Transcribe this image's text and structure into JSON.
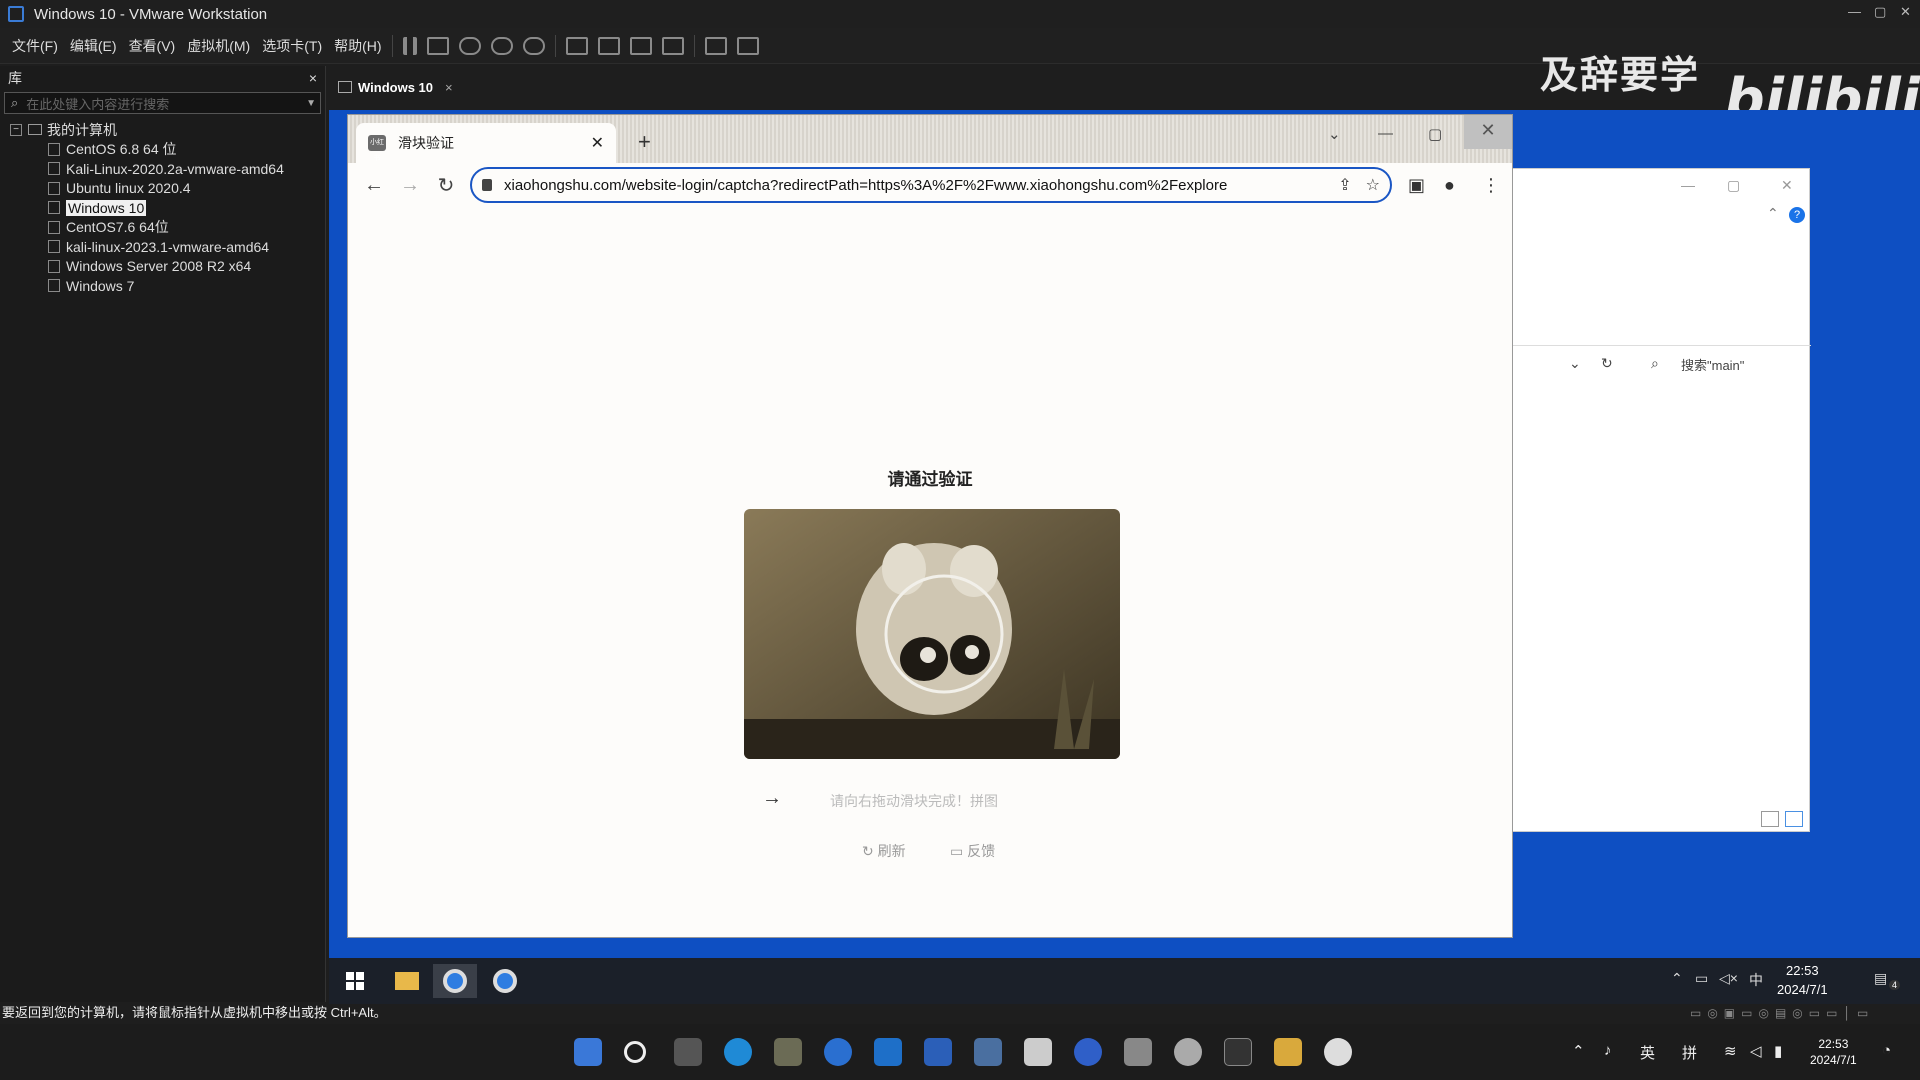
{
  "window": {
    "title": "Windows 10 - VMware Workstation"
  },
  "menu": [
    "文件(F)",
    "编辑(E)",
    "查看(V)",
    "虚拟机(M)",
    "选项卡(T)",
    "帮助(H)"
  ],
  "library": {
    "title": "库",
    "close": "×",
    "search_placeholder": "在此处键入内容进行搜索",
    "root": "我的计算机",
    "vms": [
      "CentOS 6.8 64 位",
      "Kali-Linux-2020.2a-vmware-amd64",
      "Ubuntu linux 2020.4",
      "Windows 10",
      "CentOS7.6 64位",
      "kali-linux-2023.1-vmware-amd64",
      "Windows Server 2008 R2 x64",
      "Windows 7"
    ],
    "selected": "Windows 10"
  },
  "vm_tab": {
    "label": "Windows 10",
    "close": "×"
  },
  "watermark": {
    "text": "及辞要学习",
    "logo": "bilibili"
  },
  "status_bar": {
    "text": "要返回到您的计算机，请将鼠标指针从虚拟机中移出或按 Ctrl+Alt。"
  },
  "chrome": {
    "tab_title": "滑块验证",
    "tab_favicon": "小红书",
    "new_tab": "+",
    "url": "xiaohongshu.com/website-login/captcha?redirectPath=https%3A%2F%2Fwww.xiaohongshu.com%2Fexplore",
    "page": {
      "title": "请通过验证",
      "slider_hint": "请向右拖动滑块完成！拼图",
      "refresh": "刷新",
      "feedback": "反馈"
    }
  },
  "explorer": {
    "search_placeholder": "搜索\"main\""
  },
  "guest_taskbar": {
    "time": "22:53",
    "date": "2024/7/1",
    "ime": "中",
    "notifications": "4"
  },
  "host_taskbar": {
    "time": "22:53",
    "date": "2024/7/1",
    "ime_lang": "英",
    "ime_mode": "拼"
  },
  "icons": [
    "search-icon",
    "back-arrow-icon",
    "forward-arrow-icon",
    "reload-icon",
    "lock-icon",
    "share-icon",
    "star-icon",
    "side-panel-icon",
    "profile-icon",
    "more-icon",
    "close-icon",
    "refresh-icon",
    "feedback-icon"
  ],
  "colors": {
    "guest_desktop": "#0e4fc2",
    "omnibox_border": "#1a56c4",
    "host_bg": "#1e1e1e"
  }
}
